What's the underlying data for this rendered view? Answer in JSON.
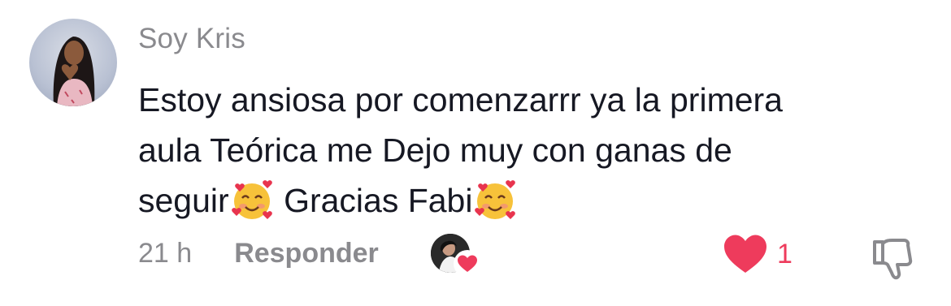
{
  "comment": {
    "username": "Soy Kris",
    "text_line1": "Estoy ansiosa por comenzarrr ya la primera",
    "text_line2": "aula Teórica me Dejo muy con ganas de",
    "text_line3a": "seguir",
    "text_line3b": " Gracias Fabi",
    "emoji_icon": "smiling-face-with-hearts-emoji",
    "time": "21 h",
    "reply_label": "Responder",
    "like_count": "1",
    "liked": true,
    "liked_by_creator": true
  },
  "colors": {
    "text": "#161823",
    "secondary": "#8a8a8e",
    "like": "#ee3b5c"
  }
}
